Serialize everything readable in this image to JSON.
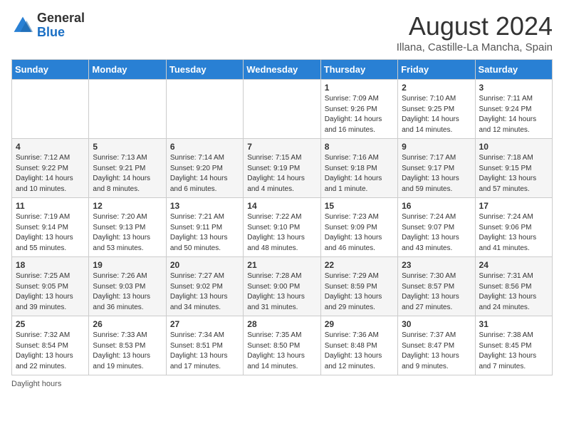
{
  "header": {
    "logo_general": "General",
    "logo_blue": "Blue",
    "month_title": "August 2024",
    "subtitle": "Illana, Castille-La Mancha, Spain"
  },
  "days_of_week": [
    "Sunday",
    "Monday",
    "Tuesday",
    "Wednesday",
    "Thursday",
    "Friday",
    "Saturday"
  ],
  "weeks": [
    [
      {
        "day": "",
        "info": ""
      },
      {
        "day": "",
        "info": ""
      },
      {
        "day": "",
        "info": ""
      },
      {
        "day": "",
        "info": ""
      },
      {
        "day": "1",
        "info": "Sunrise: 7:09 AM\nSunset: 9:26 PM\nDaylight: 14 hours\nand 16 minutes."
      },
      {
        "day": "2",
        "info": "Sunrise: 7:10 AM\nSunset: 9:25 PM\nDaylight: 14 hours\nand 14 minutes."
      },
      {
        "day": "3",
        "info": "Sunrise: 7:11 AM\nSunset: 9:24 PM\nDaylight: 14 hours\nand 12 minutes."
      }
    ],
    [
      {
        "day": "4",
        "info": "Sunrise: 7:12 AM\nSunset: 9:22 PM\nDaylight: 14 hours\nand 10 minutes."
      },
      {
        "day": "5",
        "info": "Sunrise: 7:13 AM\nSunset: 9:21 PM\nDaylight: 14 hours\nand 8 minutes."
      },
      {
        "day": "6",
        "info": "Sunrise: 7:14 AM\nSunset: 9:20 PM\nDaylight: 14 hours\nand 6 minutes."
      },
      {
        "day": "7",
        "info": "Sunrise: 7:15 AM\nSunset: 9:19 PM\nDaylight: 14 hours\nand 4 minutes."
      },
      {
        "day": "8",
        "info": "Sunrise: 7:16 AM\nSunset: 9:18 PM\nDaylight: 14 hours\nand 1 minute."
      },
      {
        "day": "9",
        "info": "Sunrise: 7:17 AM\nSunset: 9:17 PM\nDaylight: 13 hours\nand 59 minutes."
      },
      {
        "day": "10",
        "info": "Sunrise: 7:18 AM\nSunset: 9:15 PM\nDaylight: 13 hours\nand 57 minutes."
      }
    ],
    [
      {
        "day": "11",
        "info": "Sunrise: 7:19 AM\nSunset: 9:14 PM\nDaylight: 13 hours\nand 55 minutes."
      },
      {
        "day": "12",
        "info": "Sunrise: 7:20 AM\nSunset: 9:13 PM\nDaylight: 13 hours\nand 53 minutes."
      },
      {
        "day": "13",
        "info": "Sunrise: 7:21 AM\nSunset: 9:11 PM\nDaylight: 13 hours\nand 50 minutes."
      },
      {
        "day": "14",
        "info": "Sunrise: 7:22 AM\nSunset: 9:10 PM\nDaylight: 13 hours\nand 48 minutes."
      },
      {
        "day": "15",
        "info": "Sunrise: 7:23 AM\nSunset: 9:09 PM\nDaylight: 13 hours\nand 46 minutes."
      },
      {
        "day": "16",
        "info": "Sunrise: 7:24 AM\nSunset: 9:07 PM\nDaylight: 13 hours\nand 43 minutes."
      },
      {
        "day": "17",
        "info": "Sunrise: 7:24 AM\nSunset: 9:06 PM\nDaylight: 13 hours\nand 41 minutes."
      }
    ],
    [
      {
        "day": "18",
        "info": "Sunrise: 7:25 AM\nSunset: 9:05 PM\nDaylight: 13 hours\nand 39 minutes."
      },
      {
        "day": "19",
        "info": "Sunrise: 7:26 AM\nSunset: 9:03 PM\nDaylight: 13 hours\nand 36 minutes."
      },
      {
        "day": "20",
        "info": "Sunrise: 7:27 AM\nSunset: 9:02 PM\nDaylight: 13 hours\nand 34 minutes."
      },
      {
        "day": "21",
        "info": "Sunrise: 7:28 AM\nSunset: 9:00 PM\nDaylight: 13 hours\nand 31 minutes."
      },
      {
        "day": "22",
        "info": "Sunrise: 7:29 AM\nSunset: 8:59 PM\nDaylight: 13 hours\nand 29 minutes."
      },
      {
        "day": "23",
        "info": "Sunrise: 7:30 AM\nSunset: 8:57 PM\nDaylight: 13 hours\nand 27 minutes."
      },
      {
        "day": "24",
        "info": "Sunrise: 7:31 AM\nSunset: 8:56 PM\nDaylight: 13 hours\nand 24 minutes."
      }
    ],
    [
      {
        "day": "25",
        "info": "Sunrise: 7:32 AM\nSunset: 8:54 PM\nDaylight: 13 hours\nand 22 minutes."
      },
      {
        "day": "26",
        "info": "Sunrise: 7:33 AM\nSunset: 8:53 PM\nDaylight: 13 hours\nand 19 minutes."
      },
      {
        "day": "27",
        "info": "Sunrise: 7:34 AM\nSunset: 8:51 PM\nDaylight: 13 hours\nand 17 minutes."
      },
      {
        "day": "28",
        "info": "Sunrise: 7:35 AM\nSunset: 8:50 PM\nDaylight: 13 hours\nand 14 minutes."
      },
      {
        "day": "29",
        "info": "Sunrise: 7:36 AM\nSunset: 8:48 PM\nDaylight: 13 hours\nand 12 minutes."
      },
      {
        "day": "30",
        "info": "Sunrise: 7:37 AM\nSunset: 8:47 PM\nDaylight: 13 hours\nand 9 minutes."
      },
      {
        "day": "31",
        "info": "Sunrise: 7:38 AM\nSunset: 8:45 PM\nDaylight: 13 hours\nand 7 minutes."
      }
    ]
  ],
  "footer": {
    "daylight_label": "Daylight hours"
  }
}
